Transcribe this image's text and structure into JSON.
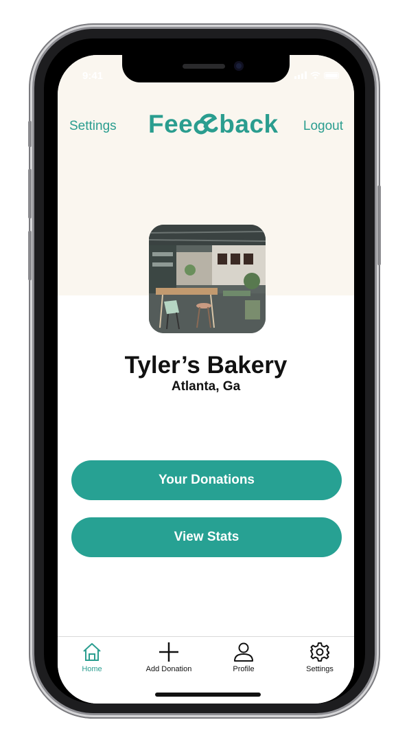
{
  "status_bar": {
    "time": "9:41"
  },
  "header": {
    "left_link": "Settings",
    "brand": "Feedback",
    "right_link": "Logout"
  },
  "profile": {
    "name": "Tyler’s Bakery",
    "location": "Atlanta, Ga",
    "avatar_icon": "restaurant-interior-photo"
  },
  "actions": {
    "donations_label": "Your Donations",
    "stats_label": "View Stats"
  },
  "tabs": [
    {
      "label": "Home",
      "icon": "home-icon",
      "active": true
    },
    {
      "label": "Add Donation",
      "icon": "plus-icon",
      "active": false
    },
    {
      "label": "Profile",
      "icon": "person-icon",
      "active": false
    },
    {
      "label": "Settings",
      "icon": "gear-icon",
      "active": false
    }
  ],
  "colors": {
    "accent": "#2a9d8f",
    "button": "#27a193",
    "hero_bg": "#faf6ef"
  }
}
